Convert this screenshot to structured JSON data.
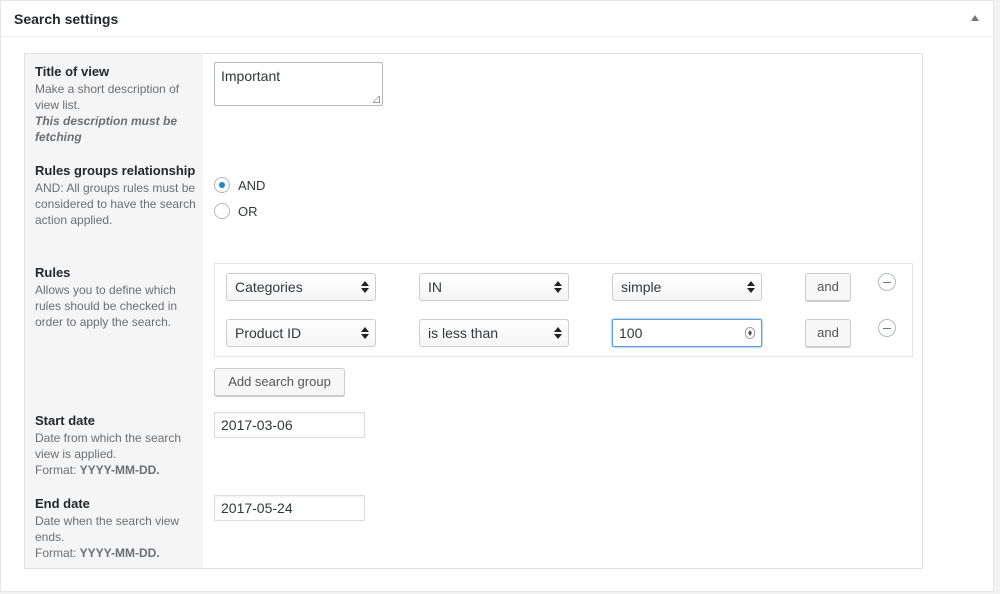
{
  "panel": {
    "title": "Search settings",
    "toggle_icon": "triangle-up-icon"
  },
  "title_of_view": {
    "label": "Title of view",
    "description": "Make a short description of view list.",
    "note": "This description must be fetching",
    "value": "Important"
  },
  "relationship": {
    "label": "Rules groups relationship",
    "description": "AND: All groups rules must be considered to have the search action applied.",
    "options": [
      {
        "label": "AND",
        "checked": true
      },
      {
        "label": "OR",
        "checked": false
      }
    ]
  },
  "rules": {
    "label": "Rules",
    "description": "Allows you to define which rules should be checked in order to apply the search.",
    "rows": [
      {
        "field": "Categories",
        "operator": "IN",
        "value": "simple",
        "value_type": "select",
        "connector": "and"
      },
      {
        "field": "Product ID",
        "operator": "is less than",
        "value": "100",
        "value_type": "number",
        "connector": "and"
      }
    ],
    "remove_icon": "minus-circle-icon",
    "add_group_label": "Add search group"
  },
  "start_date": {
    "label": "Start date",
    "description": "Date from which the search view is applied.",
    "format_prefix": "Format: ",
    "format": "YYYY-MM-DD.",
    "value": "2017-03-06"
  },
  "end_date": {
    "label": "End date",
    "description": "Date when the search view ends.",
    "format_prefix": "Format: ",
    "format": "YYYY-MM-DD.",
    "value": "2017-05-24"
  },
  "colors": {
    "radio_accent": "#1e8cbe",
    "focus_border": "#5b9dd9",
    "label_column_bg": "#f5f5f5"
  }
}
